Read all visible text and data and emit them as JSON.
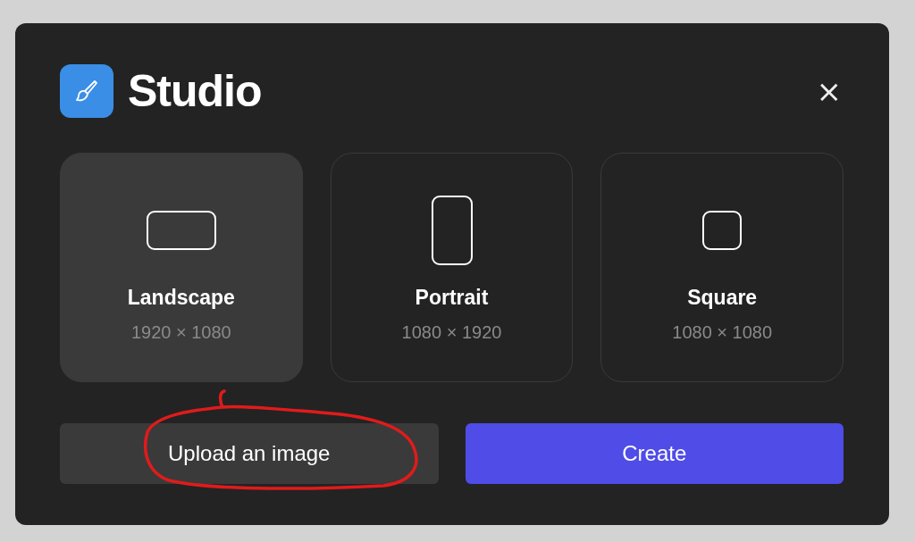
{
  "dialog": {
    "title": "Studio",
    "close": "×"
  },
  "formats": [
    {
      "kind": "landscape",
      "label": "Landscape",
      "size": "1920 × 1080",
      "selected": true
    },
    {
      "kind": "portrait",
      "label": "Portrait",
      "size": "1080 × 1920",
      "selected": false
    },
    {
      "kind": "square",
      "label": "Square",
      "size": "1080 × 1080",
      "selected": false
    }
  ],
  "buttons": [
    {
      "kind": "secondary",
      "label": "Upload an image"
    },
    {
      "kind": "primary",
      "label": "Create"
    }
  ],
  "annotation": {
    "kind": "freehand-loop",
    "color": "#e01b1b"
  }
}
